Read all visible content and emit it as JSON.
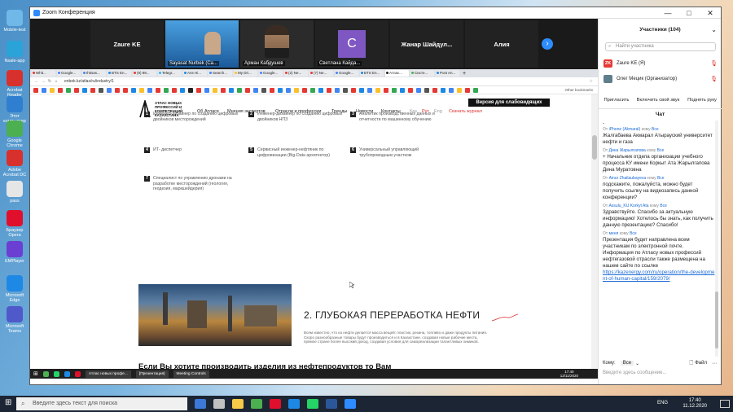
{
  "desktop": {
    "icons": [
      {
        "label": "Mobile-test",
        "color": "#6fb8e8"
      },
      {
        "label": "Nsale-app",
        "color": "#2aa3d8"
      },
      {
        "label": "Acrobat Reader",
        "color": "#d8312d"
      },
      {
        "label": "Этот компьютер",
        "color": "#2f7fd1"
      },
      {
        "label": "Google Chrome",
        "color": "#4caf50"
      },
      {
        "label": "Adobe Acrobat DC",
        "color": "#d8312d"
      },
      {
        "label": "pass",
        "color": "#e6e6e6"
      },
      {
        "label": "Браузер Opera",
        "color": "#e0102c"
      },
      {
        "label": "EMPlayer",
        "color": "#6b3fd1"
      },
      {
        "label": "Microsoft Edge",
        "color": "#1e88e5"
      },
      {
        "label": "Microsoft Teams",
        "color": "#5059c9"
      }
    ]
  },
  "zoom": {
    "title": "Zoom Конференция",
    "window_controls": [
      "—",
      "□",
      "✕"
    ],
    "video_tiles": [
      {
        "label": "Zaure KE",
        "name": "",
        "type": "text"
      },
      {
        "label": "",
        "name": "Sayasat Nurbek (Ca...",
        "type": "video"
      },
      {
        "label": "",
        "name": "Арман Кабдушев",
        "type": "video"
      },
      {
        "label": "C",
        "name": "Светлана Кайда...",
        "type": "avatar"
      },
      {
        "label": "Жанар  Шайдул...",
        "name": "",
        "type": "text"
      },
      {
        "label": "Алия",
        "name": "",
        "type": "text"
      }
    ],
    "next_button": "›"
  },
  "browser": {
    "tabs": [
      {
        "label": "Whit...",
        "color": "#e53935"
      },
      {
        "label": "Google...",
        "color": "#4285f4"
      },
      {
        "label": "Ihtisas...",
        "color": "#4285f4"
      },
      {
        "label": "BTS En...",
        "color": "#1e88e5"
      },
      {
        "label": "(9) 99...",
        "color": "#e53935"
      },
      {
        "label": "Telegr...",
        "color": "#29b6f6"
      },
      {
        "label": "Ans Hi...",
        "color": "#1e88e5"
      },
      {
        "label": "Search...",
        "color": "#4285f4"
      },
      {
        "label": "My Dri...",
        "color": "#fbc02d"
      },
      {
        "label": "Google...",
        "color": "#4285f4"
      },
      {
        "label": "(2) Ne...",
        "color": "#e53935"
      },
      {
        "label": "(7) Ne...",
        "color": "#e53935"
      },
      {
        "label": "Google...",
        "color": "#4285f4"
      },
      {
        "label": "BTS En...",
        "color": "#1e88e5"
      },
      {
        "label": "Атлас...",
        "color": "#222222",
        "active": true
      },
      {
        "label": "Систе...",
        "color": "#4caf50"
      },
      {
        "label": "Post An...",
        "color": "#1e88e5"
      }
    ],
    "url": "enbek.kz/atlas/ru/industry/1",
    "other_bookmarks": "Other bookmarks",
    "bookmark_colors": [
      "#e53935",
      "#4285f4",
      "#fbc02d",
      "#e53935",
      "#34a853",
      "#e53935",
      "#1e88e5",
      "#e53935",
      "#555555",
      "#4285f4",
      "#e53935",
      "#e53935",
      "#1e88e5",
      "#fbc02d",
      "#4285f4",
      "#e53935",
      "#34a853",
      "#e53935",
      "#1e88e5",
      "#222222",
      "#e53935",
      "#4285f4",
      "#fbc02d",
      "#e53935",
      "#1e88e5",
      "#34a853",
      "#e53935",
      "#4285f4",
      "#555555",
      "#e53935",
      "#1e88e5",
      "#4285f4",
      "#fbc02d",
      "#e53935",
      "#34a853",
      "#1e88e5",
      "#e53935",
      "#4285f4",
      "#555555",
      "#e53935",
      "#1e88e5",
      "#4285f4",
      "#fbc02d",
      "#e53935",
      "#34a853",
      "#1e88e5",
      "#e53935",
      "#4285f4",
      "#555555",
      "#e53935",
      "#1e88e5",
      "#4285f4",
      "#fbc02d",
      "#e53935",
      "#34a853"
    ]
  },
  "site": {
    "logo_text": "АТЛАС НОВЫХ ПРОФЕССИЙ И КОМПЕТЕНЦИЙ КАЗАХСТАНА",
    "nav": [
      "Об Атласе",
      "Мнения экспертов",
      "Отрасли и профессии",
      "Тренды",
      "Новости",
      "Контакты",
      "Қаз",
      "Рус",
      "Eng",
      "Скачать журнал"
    ],
    "low_vision_button": "Версия для слабовидящих",
    "professions": [
      {
        "num": "1",
        "text": "Инженер-дизайнер по созданию цифровых двойников месторождений"
      },
      {
        "num": "2",
        "text": "Инженер-дизайнер по созданию цифровых двойников НПЗ"
      },
      {
        "num": "3",
        "text": "Аналитик производственных данных и отчетности по машинному обучению"
      },
      {
        "num": "4",
        "text": "ИТ- диспетчер"
      },
      {
        "num": "5",
        "text": "Сервисный инженер-нефтяник по цифровизации (Big-Data архитектор)"
      },
      {
        "num": "6",
        "text": "Универсальный управляющий трубопроводным участком"
      },
      {
        "num": "7",
        "text": "Специалист по управлению дронами на разработке месторождений (геология, геодезия, маркшейдерия)"
      }
    ],
    "section_title": "2. ГЛУБОКАЯ ПЕРЕРАБОТКА НЕФТИ",
    "section_desc": "Всем известно, что из нефти делается масса вещей: пластик, резина, топливо и даже продукты питания. Скоро разнообразные товары будут производиться и в Казахстане, создавая новые рабочие места, прямое стране более высокий доход, создавая условия для самореализации талантливых химиков.",
    "cta_text": "Если Вы хотите производить изделия из нефтепродуктов то Вам следует выбрать одну из таких профессий будущего, как:"
  },
  "screen_taskbar": {
    "apps": [
      {
        "label": "Атлас новых профе...",
        "color": "#e53935"
      },
      {
        "label": "[Презентация]",
        "color": "#d24726"
      },
      {
        "label": "Meeting Controls",
        "color": "#2d8cff"
      }
    ],
    "clock": "17:40",
    "date": "12/11/2020"
  },
  "sidebar": {
    "participants_title": "Участники (104)",
    "search_placeholder": "Найти участника",
    "participants": [
      {
        "initials": "ZK",
        "name": "Zaure KE (Я)",
        "color": "#e53935"
      },
      {
        "initials": "",
        "name": "Олег Мецик (Организатор)",
        "color": "#607d8b"
      }
    ],
    "buttons": [
      "Пригласить",
      "Включить свой звук",
      "Поднять руку"
    ],
    "chat_title": "Чат",
    "messages": [
      {
        "from": "iPhone (Akmaral)",
        "to": "Все",
        "text": "Жалгабаева Акмарал Атырауский университет нефти и газа"
      },
      {
        "from": "Дина Жарылгапова",
        "to": "Все",
        "text": "+ Начальник отдела организации учебного процесса КУ имени Коркыт Ата Жарылгапова Дина Муратовна"
      },
      {
        "from": "Ainur Zhailaubayeva",
        "to": "Все",
        "text": "подскажите, пожалуйста, можно будет получить ссылку на видеозапись данной конференции?"
      },
      {
        "from": "Assulu_KU Korkyt Ata",
        "to": "Все",
        "text": "Здравствуйте. Спасибо за актуальную информацию! Хотелось бы знать, как получить данную презентацию? Спасибо!"
      },
      {
        "from": "меня",
        "to": "Все",
        "text": "Презентация будет направлена всем участникам по электронной почте. Информация по Атласу новых профессий нефтегазовой отрасли также размещена на нашем сайте по ссылке",
        "link": "https://kazenergy.com/ru/operation/the-development-of-human-capital/159/2079/"
      }
    ],
    "to_label": "Кому:",
    "to_value": "Все",
    "file_label": "Файл",
    "input_placeholder": "Введите здесь сообщение..."
  },
  "os_taskbar": {
    "search_placeholder": "Введите здесь текст для поиска",
    "apps": [
      "#3b78d8",
      "#c1c1c1",
      "#f7c948",
      "#4caf50",
      "#e0102c",
      "#1e88e5",
      "#25d366",
      "#2b579a",
      "#2d8cff"
    ],
    "language": "ENG",
    "time": "17:40",
    "date": "11.12.2020"
  }
}
